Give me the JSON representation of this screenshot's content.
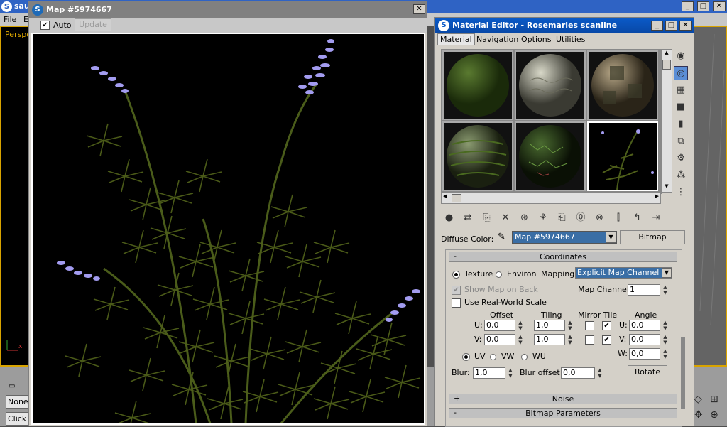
{
  "back_app": {
    "title": "sau",
    "menu": [
      "File",
      "E"
    ],
    "viewport_label": "Perspe",
    "axis_label": "x",
    "bottom": {
      "none_label": "None",
      "click_label": "Click"
    }
  },
  "map_window": {
    "title": "Map #5974667",
    "close_label": "✕",
    "auto_label": "Auto",
    "auto_checked": "✔",
    "update_label": "Update"
  },
  "material_editor": {
    "title": "Material Editor - Rosemaries scanline",
    "window_buttons": [
      "_",
      "□",
      "✕"
    ],
    "menu": [
      "Material",
      "Navigation",
      "Options",
      "Utilities"
    ],
    "diffuse_label": "Diffuse Color:",
    "map_name": "Map #5974667",
    "bitmap_button": "Bitmap",
    "coordinates_header": "Coordinates",
    "texture_label": "Texture",
    "environ_label": "Environ",
    "mapping_label": "Mapping:",
    "mapping_value": "Explicit Map Channel",
    "show_map_label": "Show Map on Back",
    "map_channel_label": "Map Channel:",
    "map_channel_value": "1",
    "real_world_label": "Use Real-World Scale",
    "offset_label": "Offset",
    "tiling_label": "Tiling",
    "mirror_tile_label": "Mirror Tile",
    "angle_label": "Angle",
    "u_label": "U:",
    "v_label": "V:",
    "w_label": "W:",
    "u_offset": "0,0",
    "v_offset": "0,0",
    "u_tiling": "1,0",
    "v_tiling": "1,0",
    "u_angle": "0,0",
    "v_angle": "0,0",
    "w_angle": "0,0",
    "uv_label": "UV",
    "vw_label": "VW",
    "wu_label": "WU",
    "blur_label": "Blur:",
    "blur_value": "1,0",
    "blur_offset_label": "Blur offset:",
    "blur_offset_value": "0,0",
    "rotate_button": "Rotate",
    "noise_header": "Noise",
    "bitmap_params_header": "Bitmap Parameters",
    "plus_sign": "+",
    "minus_sign": "-"
  }
}
